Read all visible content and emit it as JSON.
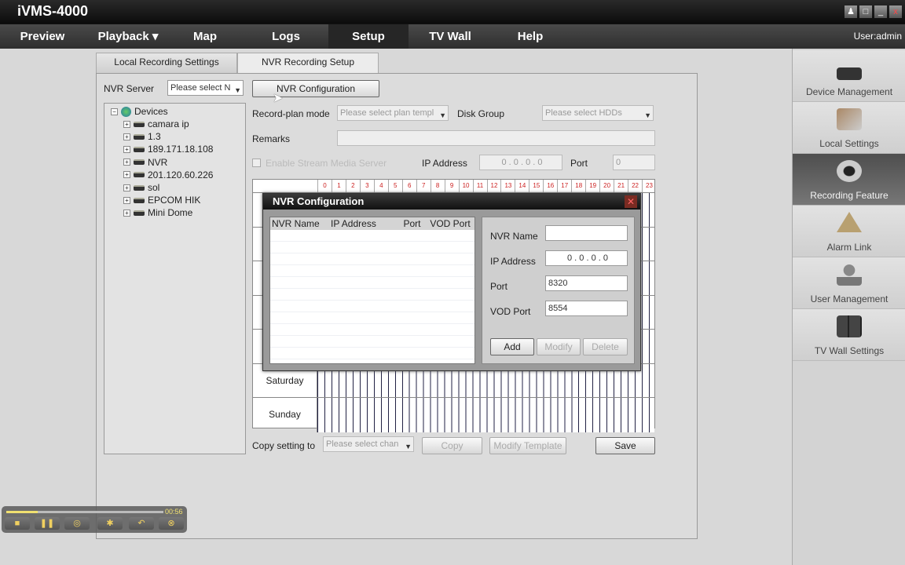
{
  "app": {
    "title": "iVMS-4000",
    "user": "User:admin"
  },
  "window_buttons": [
    "user-icon",
    "lock-icon",
    "minimize-icon",
    "close-icon"
  ],
  "nav": [
    {
      "label": "Preview"
    },
    {
      "label": "Playback ▾"
    },
    {
      "label": "Map"
    },
    {
      "label": "Logs"
    },
    {
      "label": "Setup",
      "active": true
    },
    {
      "label": "TV Wall"
    },
    {
      "label": "Help"
    }
  ],
  "tabs": [
    {
      "label": "Local Recording Settings"
    },
    {
      "label": "NVR Recording Setup",
      "active": true
    }
  ],
  "form": {
    "nvr_server_label": "NVR Server",
    "nvr_server_value": "Please select N",
    "nvr_config_button": "NVR Configuration",
    "record_plan_label": "Record-plan mode",
    "record_plan_value": "Please select plan templ",
    "disk_group_label": "Disk Group",
    "disk_group_value": "Please select HDDs",
    "remarks_label": "Remarks",
    "remarks_value": "",
    "stream_media_label": "Enable Stream Media Server",
    "stream_media_checked": false,
    "ip_label": "IP Address",
    "ip_value": "0 . 0 . 0 . 0",
    "port_label": "Port",
    "port_value": "0",
    "copy_label": "Copy setting to",
    "copy_value": "Please select chan",
    "copy_button": "Copy",
    "modify_template_button": "Modify Template",
    "save_button": "Save"
  },
  "tree": {
    "root": "Devices",
    "items": [
      "camara ip",
      "1.3",
      "189.171.18.108",
      "NVR",
      "201.120.60.226",
      "sol",
      "EPCOM HIK",
      "Mini Dome"
    ]
  },
  "schedule": {
    "hours": [
      "0",
      "1",
      "2",
      "3",
      "4",
      "5",
      "6",
      "7",
      "8",
      "9",
      "10",
      "11",
      "12",
      "13",
      "14",
      "15",
      "16",
      "17",
      "18",
      "19",
      "20",
      "21",
      "22",
      "23"
    ],
    "visible_days": [
      "Saturday",
      "Sunday"
    ]
  },
  "dialog": {
    "title": "NVR Configuration",
    "columns": [
      "NVR Name",
      "IP Address",
      "Port",
      "VOD Port"
    ],
    "rows": [],
    "nvr_name_label": "NVR Name",
    "nvr_name_value": "",
    "ip_label": "IP Address",
    "ip_value": "0 . 0 . 0 . 0",
    "port_label": "Port",
    "port_value": "8320",
    "vod_port_label": "VOD Port",
    "vod_port_value": "8554",
    "add": "Add",
    "modify": "Modify",
    "delete": "Delete"
  },
  "sidebar": [
    {
      "label": "Device Management"
    },
    {
      "label": "Local Settings"
    },
    {
      "label": "Recording Feature",
      "active": true
    },
    {
      "label": "Alarm Link"
    },
    {
      "label": "User Management"
    },
    {
      "label": "TV Wall Settings"
    }
  ],
  "player": {
    "time": "00:56",
    "progress": 0.2
  },
  "colors": {
    "hour_label": "#cc2222",
    "active_side": "#5a5a5a"
  }
}
